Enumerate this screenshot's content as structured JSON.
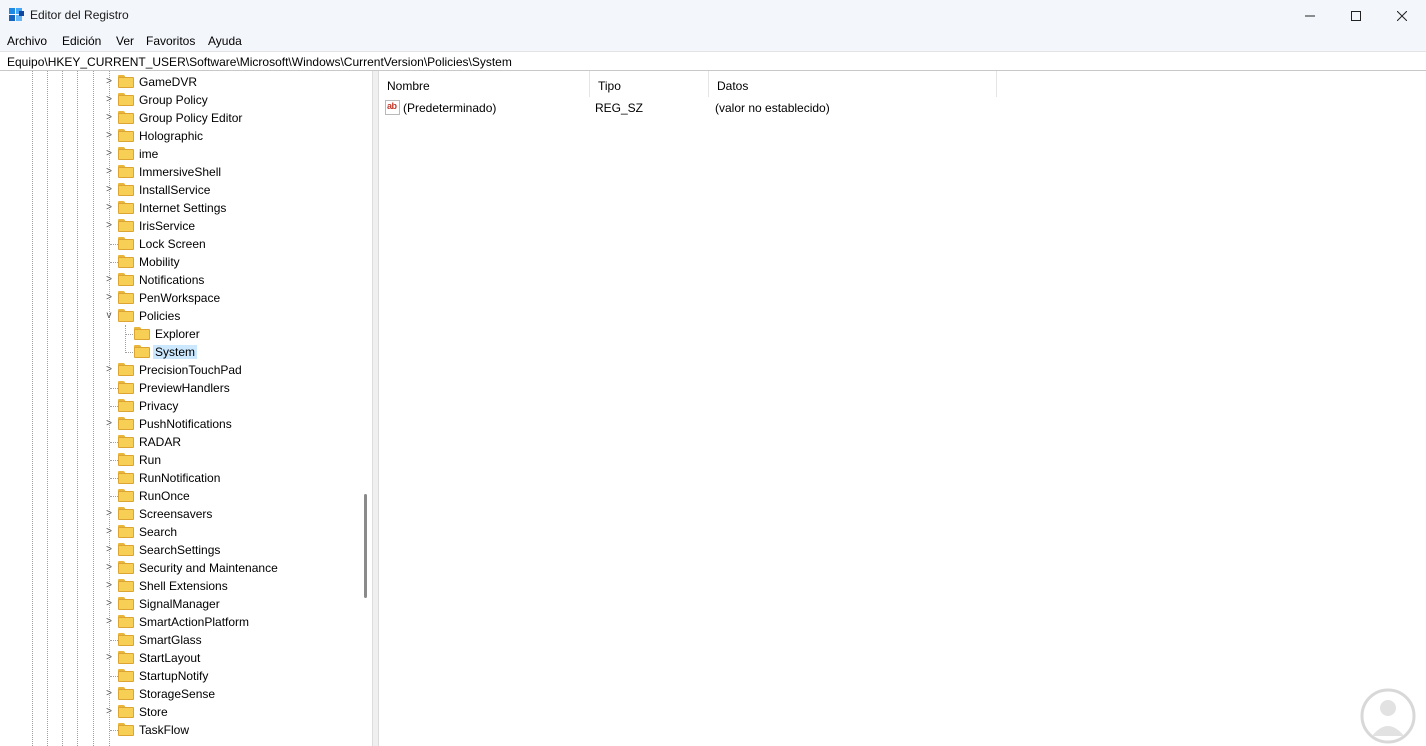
{
  "window": {
    "title": "Editor del Registro",
    "controls": [
      "minimize",
      "maximize",
      "close"
    ]
  },
  "menu": [
    "Archivo",
    "Edición",
    "Ver",
    "Favoritos",
    "Ayuda"
  ],
  "address": "Equipo\\HKEY_CURRENT_USER\\Software\\Microsoft\\Windows\\CurrentVersion\\Policies\\System",
  "tree": {
    "items": [
      {
        "label": "GameDVR",
        "expander": ">"
      },
      {
        "label": "Group Policy",
        "expander": ">"
      },
      {
        "label": "Group Policy Editor",
        "expander": ">"
      },
      {
        "label": "Holographic",
        "expander": ">"
      },
      {
        "label": "ime",
        "expander": ">"
      },
      {
        "label": "ImmersiveShell",
        "expander": ">"
      },
      {
        "label": "InstallService",
        "expander": ">"
      },
      {
        "label": "Internet Settings",
        "expander": ">"
      },
      {
        "label": "IrisService",
        "expander": ">"
      },
      {
        "label": "Lock Screen",
        "expander": ""
      },
      {
        "label": "Mobility",
        "expander": ""
      },
      {
        "label": "Notifications",
        "expander": ">"
      },
      {
        "label": "PenWorkspace",
        "expander": ">"
      },
      {
        "label": "Policies",
        "expander": "v"
      },
      {
        "label": "Explorer",
        "expander": "",
        "child": true
      },
      {
        "label": "System",
        "expander": "",
        "child": true,
        "selected": true
      },
      {
        "label": "PrecisionTouchPad",
        "expander": ">"
      },
      {
        "label": "PreviewHandlers",
        "expander": ""
      },
      {
        "label": "Privacy",
        "expander": ""
      },
      {
        "label": "PushNotifications",
        "expander": ">"
      },
      {
        "label": "RADAR",
        "expander": ""
      },
      {
        "label": "Run",
        "expander": ""
      },
      {
        "label": "RunNotification",
        "expander": ""
      },
      {
        "label": "RunOnce",
        "expander": ""
      },
      {
        "label": "Screensavers",
        "expander": ">"
      },
      {
        "label": "Search",
        "expander": ">"
      },
      {
        "label": "SearchSettings",
        "expander": ">"
      },
      {
        "label": "Security and Maintenance",
        "expander": ">"
      },
      {
        "label": "Shell Extensions",
        "expander": ">"
      },
      {
        "label": "SignalManager",
        "expander": ">"
      },
      {
        "label": "SmartActionPlatform",
        "expander": ">"
      },
      {
        "label": "SmartGlass",
        "expander": ""
      },
      {
        "label": "StartLayout",
        "expander": ">"
      },
      {
        "label": "StartupNotify",
        "expander": ""
      },
      {
        "label": "StorageSense",
        "expander": ">"
      },
      {
        "label": "Store",
        "expander": ">"
      },
      {
        "label": "TaskFlow",
        "expander": ""
      }
    ]
  },
  "list": {
    "columns": [
      "Nombre",
      "Tipo",
      "Datos"
    ],
    "rows": [
      {
        "icon": "string-value-icon",
        "icon_text": "ab",
        "name": "(Predeterminado)",
        "type": "REG_SZ",
        "data": "(valor no establecido)"
      }
    ]
  },
  "colors": {
    "chrome": "#f3f6fb",
    "selection": "#cce8ff",
    "folder": "#f8cf55"
  }
}
